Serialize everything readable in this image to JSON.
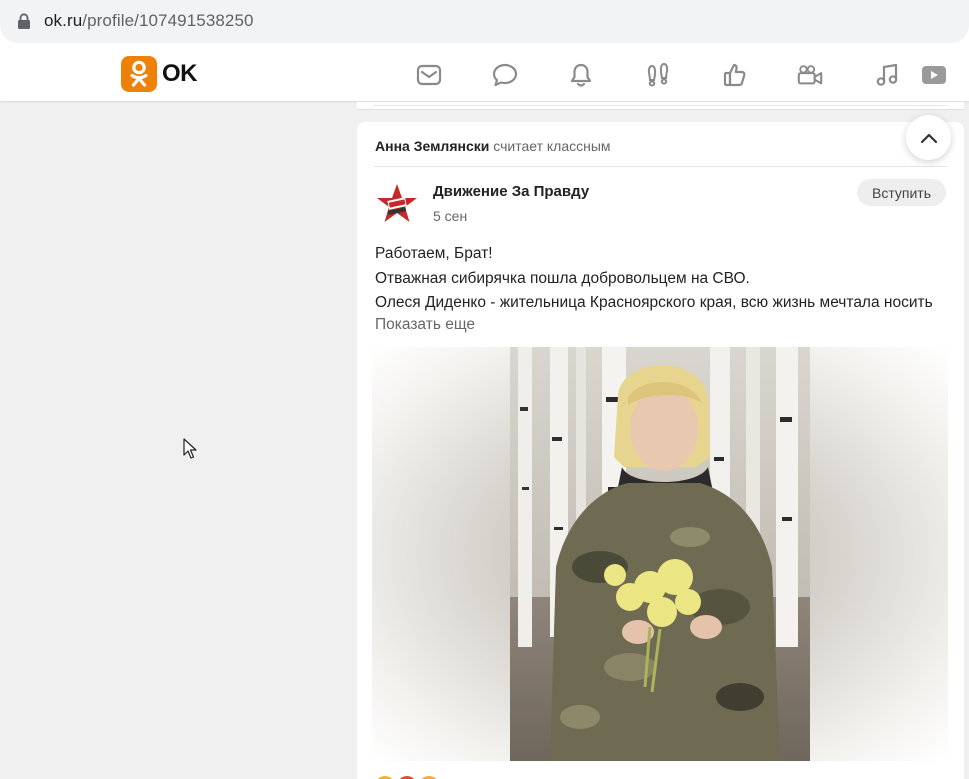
{
  "browser": {
    "url_host": "ok.ru",
    "url_path": "/profile/107491538250"
  },
  "header": {
    "logo_text": "OK",
    "nav_icons": [
      "mail-icon",
      "chat-icon",
      "bell-icon",
      "guests-icon",
      "like-icon",
      "video-camera-icon",
      "music-icon",
      "video-play-icon"
    ]
  },
  "feed": {
    "activity_author": "Анна Землянски",
    "activity_text": "считает классным",
    "group_name": "Движение За Правду",
    "post_date": "5 сен",
    "join_label": "Вступить",
    "post_lines": [
      "Работаем, Брат!",
      "Отважная сибирячка пошла добровольцем на СВО.",
      "Олеся Диденко - жительница Красноярского края, всю жизнь мечтала носить"
    ],
    "show_more_label": "Показать еще"
  },
  "colors": {
    "brand": "#ee8208",
    "background": "#f0f0f0",
    "card": "#ffffff"
  }
}
